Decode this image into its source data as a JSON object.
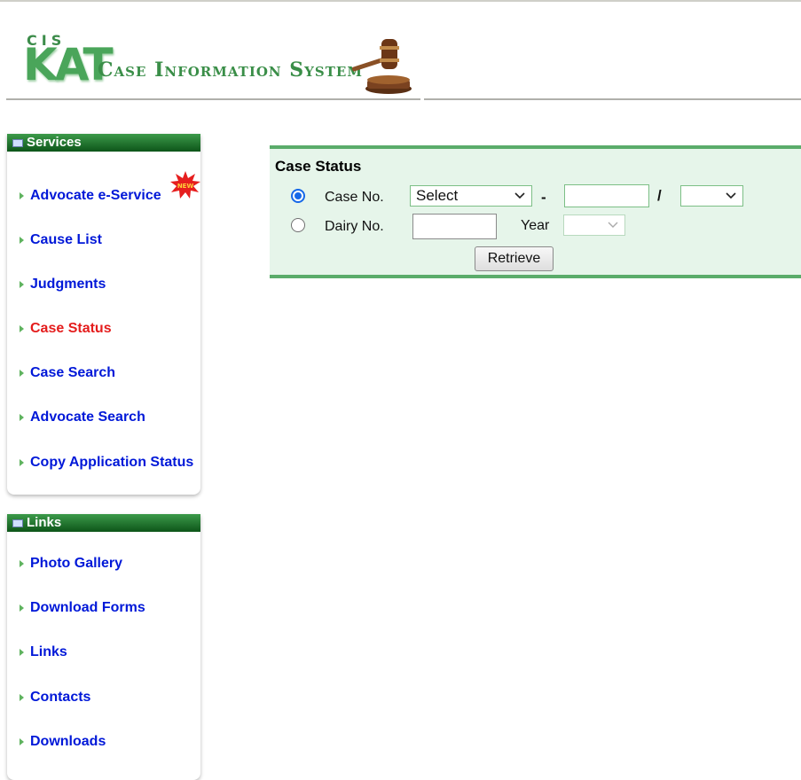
{
  "header": {
    "logo_cis": "CIS",
    "logo_kat": "KAT",
    "logo_title": "Case Information System"
  },
  "services": {
    "title": "Services",
    "new_badge": "NEW",
    "items": [
      {
        "label": "Advocate e-Service"
      },
      {
        "label": "Cause List"
      },
      {
        "label": "Judgments"
      },
      {
        "label": "Case Status"
      },
      {
        "label": "Case Search"
      },
      {
        "label": "Advocate Search"
      },
      {
        "label": "Copy Application Status"
      }
    ]
  },
  "links": {
    "title": "Links",
    "items": [
      {
        "label": "Photo Gallery"
      },
      {
        "label": "Download Forms"
      },
      {
        "label": "Links"
      },
      {
        "label": "Contacts"
      },
      {
        "label": "Downloads"
      }
    ]
  },
  "case_status": {
    "title": "Case Status",
    "case_no_label": "Case No.",
    "case_type_selected": "Select",
    "dash": "-",
    "slash": "/",
    "dairy_no_label": "Dairy No.",
    "year_label": "Year",
    "retrieve_label": "Retrieve",
    "selected_option": "case-no"
  },
  "colors": {
    "nav_link": "#0018d8",
    "nav_active": "#e41c1c",
    "panel_header": "#0d5519",
    "status_bg": "#e6f5ea",
    "status_border": "#5aac6a"
  }
}
